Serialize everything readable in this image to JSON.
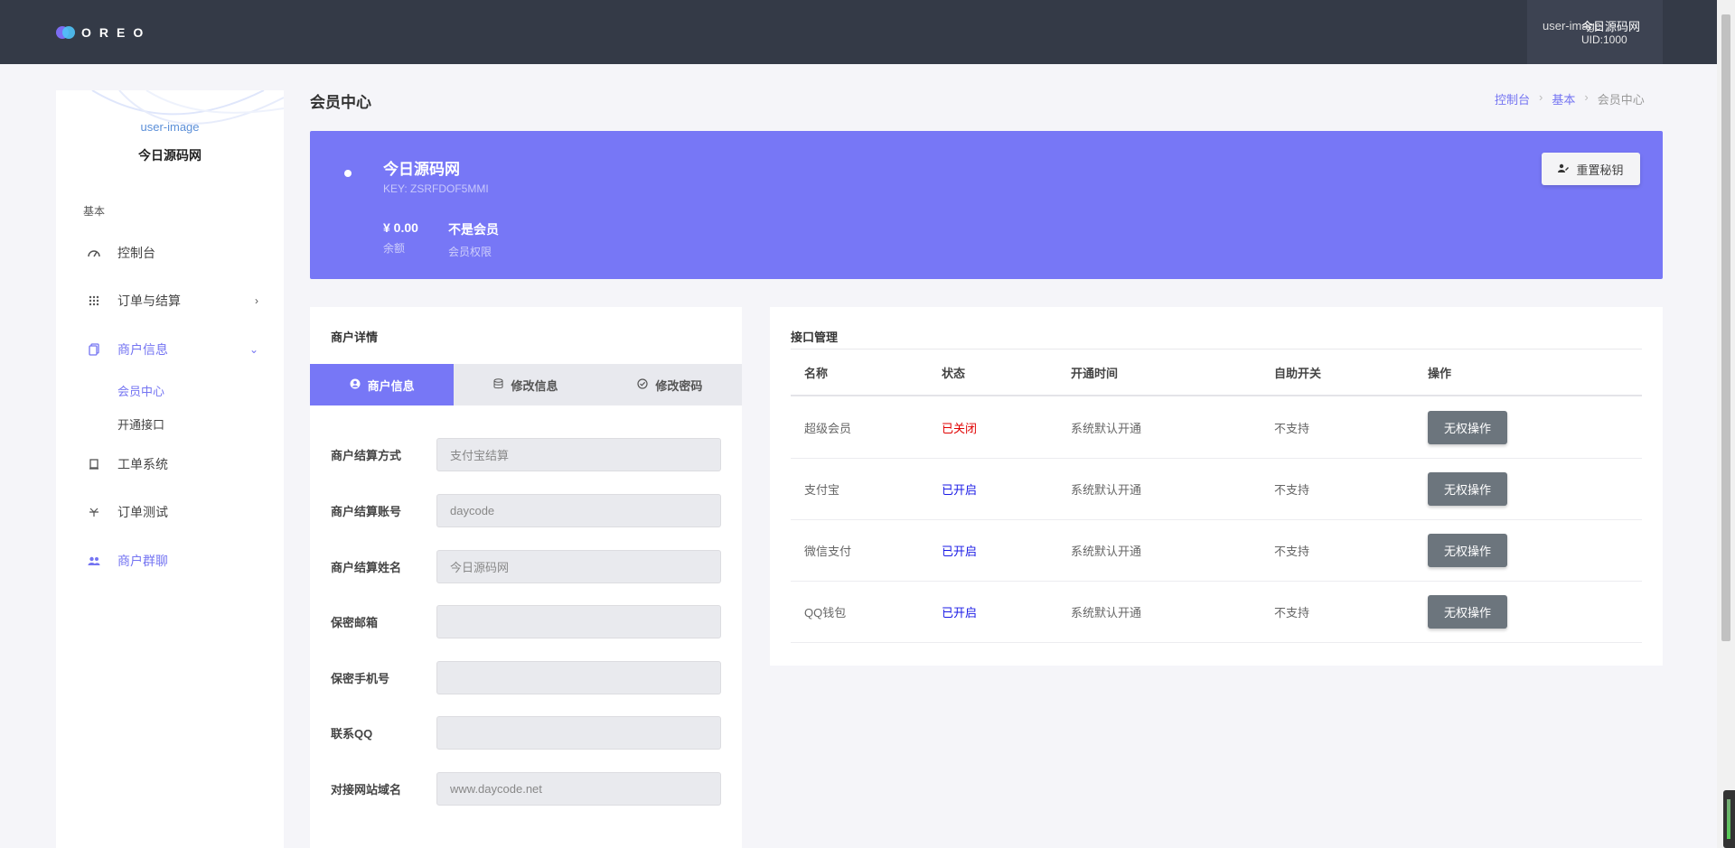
{
  "topbar": {
    "logo_text": "OREO",
    "user_image_alt": "user-image",
    "user_name": "今日源码网",
    "user_uid": "UID:1000"
  },
  "sidebar": {
    "avatar_alt": "user-image",
    "user_name": "今日源码网",
    "group_label": "基本",
    "items": [
      {
        "label": "控制台",
        "icon": "gauge-icon"
      },
      {
        "label": "订单与结算",
        "icon": "grid-icon",
        "arrow": "chevron-right-icon"
      },
      {
        "label": "商户信息",
        "icon": "copy-icon",
        "arrow": "chevron-down-icon",
        "active": true
      },
      {
        "label": "工单系统",
        "icon": "ticket-icon"
      },
      {
        "label": "订单测试",
        "icon": "fork-icon"
      },
      {
        "label": "商户群聊",
        "icon": "users-icon"
      }
    ],
    "sub_items": [
      {
        "label": "会员中心",
        "active": true
      },
      {
        "label": "开通接口"
      }
    ]
  },
  "header": {
    "title": "会员中心",
    "breadcrumb": [
      "控制台",
      "基本",
      "会员中心"
    ]
  },
  "banner": {
    "name": "今日源码网",
    "key": "KEY: ZSRFDOF5MMI",
    "balance_value": "¥ 0.00",
    "balance_label": "余额",
    "member_value": "不是会员",
    "member_label": "会员权限",
    "reset_button": "重置秘钥"
  },
  "merchant": {
    "card_title": "商户详情",
    "tabs": [
      "商户信息",
      "修改信息",
      "修改密码"
    ],
    "fields": [
      {
        "label": "商户结算方式",
        "value": "支付宝结算"
      },
      {
        "label": "商户结算账号",
        "value": "daycode"
      },
      {
        "label": "商户结算姓名",
        "value": "今日源码网"
      },
      {
        "label": "保密邮箱",
        "value": ""
      },
      {
        "label": "保密手机号",
        "value": ""
      },
      {
        "label": "联系QQ",
        "value": ""
      },
      {
        "label": "对接网站域名",
        "value": "www.daycode.net"
      }
    ]
  },
  "interfaces": {
    "card_title": "接口管理",
    "columns": [
      "名称",
      "状态",
      "开通时间",
      "自助开关",
      "操作"
    ],
    "rows": [
      {
        "name": "超级会员",
        "status": "已关闭",
        "time": "系统默认开通",
        "self": "不支持",
        "action": "无权操作"
      },
      {
        "name": "支付宝",
        "status": "已开启",
        "time": "系统默认开通",
        "self": "不支持",
        "action": "无权操作"
      },
      {
        "name": "微信支付",
        "status": "已开启",
        "time": "系统默认开通",
        "self": "不支持",
        "action": "无权操作"
      },
      {
        "name": "QQ钱包",
        "status": "已开启",
        "time": "系统默认开通",
        "self": "不支持",
        "action": "无权操作"
      }
    ]
  },
  "colors": {
    "topbar": "#343a47",
    "accent": "#7777f6",
    "status_off": "#e00000",
    "status_on": "#1a1ae6",
    "button_gray": "#6c757d"
  }
}
